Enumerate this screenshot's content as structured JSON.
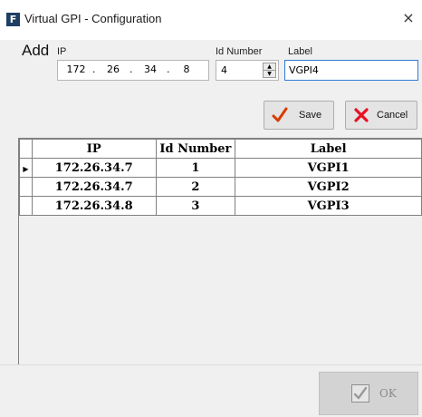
{
  "window": {
    "app_icon_letter": "F",
    "title": "Virtual GPI - Configuration",
    "close_glyph": "×"
  },
  "form": {
    "add_label": "Add",
    "ip_label": "IP",
    "ip_segments": [
      "172",
      "26",
      "34",
      "8"
    ],
    "ip_separator": ".",
    "id_label": "Id Number",
    "id_value": "4",
    "label_label": "Label",
    "label_value": "VGPI4"
  },
  "buttons": {
    "save_label": "Save",
    "save_icon": "checkmark-icon",
    "cancel_label": "Cancel",
    "cancel_icon": "cross-icon",
    "ok_label": "OK",
    "ok_icon": "checkmark-icon"
  },
  "grid": {
    "columns": [
      "IP",
      "Id Number",
      "Label"
    ],
    "rows": [
      {
        "ip": "172.26.34.7",
        "id": "1",
        "label": "VGPI1",
        "current": true
      },
      {
        "ip": "172.26.34.7",
        "id": "2",
        "label": "VGPI2",
        "current": false
      },
      {
        "ip": "172.26.34.8",
        "id": "3",
        "label": "VGPI3",
        "current": false
      }
    ]
  },
  "colors": {
    "accent_focus": "#2e7cd6",
    "save_check": "#d83b01",
    "cancel_cross": "#e81123",
    "app_icon_bg": "#1e3f63"
  }
}
